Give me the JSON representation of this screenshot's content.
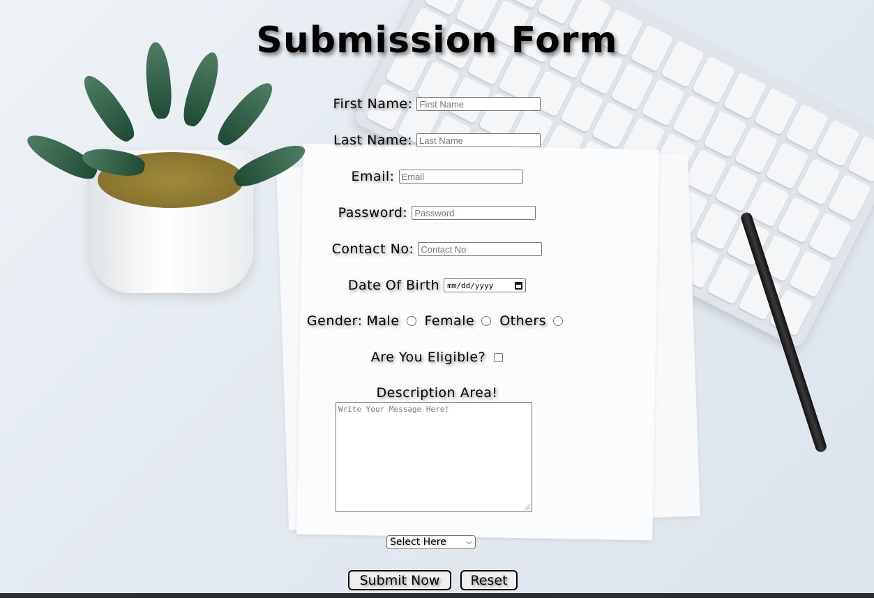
{
  "form": {
    "title": "Submission Form",
    "first_name": {
      "label": "First Name:",
      "placeholder": "First Name"
    },
    "last_name": {
      "label": "Last Name:",
      "placeholder": "Last Name"
    },
    "email": {
      "label": "Email:",
      "placeholder": "Email"
    },
    "password": {
      "label": "Password:",
      "placeholder": "Password"
    },
    "contact": {
      "label": "Contact No:",
      "placeholder": "Contact No"
    },
    "dob": {
      "label": "Date Of Birth",
      "placeholder": "mm/dd/yyyy"
    },
    "gender": {
      "label": "Gender:",
      "options": [
        "Male",
        "Female",
        "Others"
      ]
    },
    "eligible": {
      "label": "Are You Eligible?"
    },
    "description": {
      "label": "Description Area!",
      "placeholder": "Write Your Message Here!"
    },
    "select": {
      "value": "Select Here"
    },
    "buttons": {
      "submit": "Submit Now",
      "reset": "Reset"
    }
  },
  "icons": {
    "calendar": "calendar-icon",
    "dropdown": "chevron-down-icon"
  }
}
